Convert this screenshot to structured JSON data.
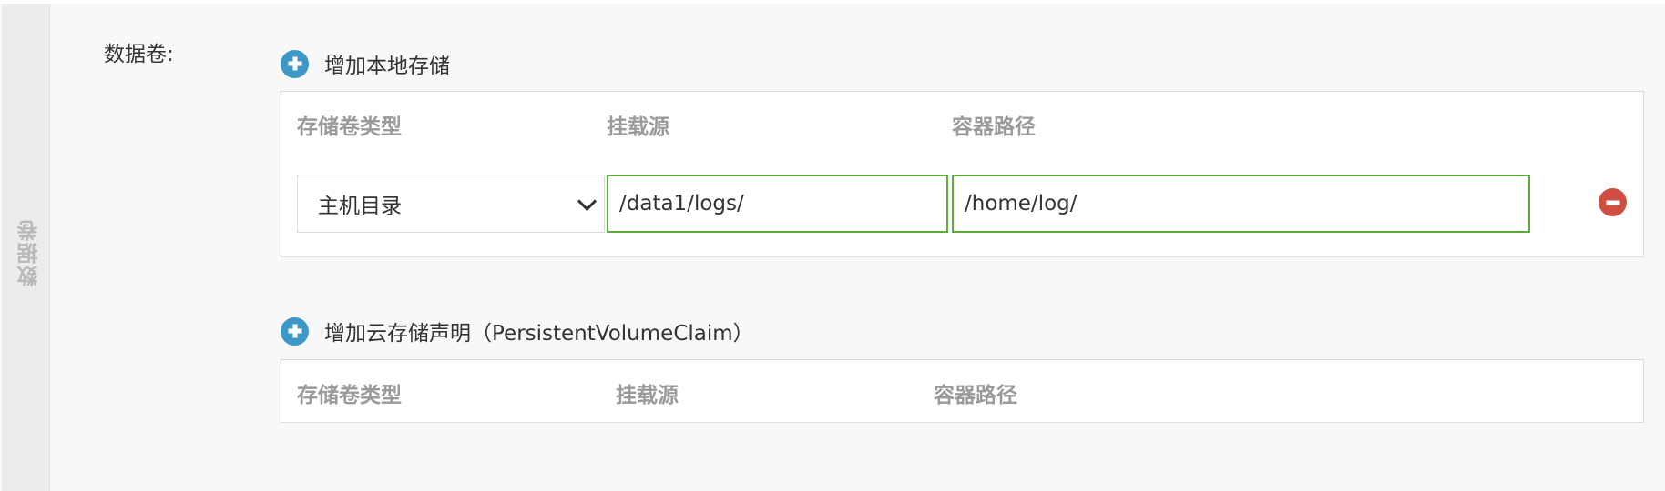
{
  "side_tab": {
    "label": "数据卷"
  },
  "field": {
    "label": "数据卷:"
  },
  "local_storage": {
    "add_label": "增加本地存储",
    "columns": [
      "存储卷类型",
      "挂载源",
      "容器路径"
    ],
    "rows": [
      {
        "type": "主机目录",
        "source": "/data1/logs/",
        "path": "/home/log/"
      }
    ]
  },
  "cloud_storage": {
    "add_label": "增加云存储声明（PersistentVolumeClaim）",
    "columns": [
      "存储卷类型",
      "挂载源",
      "容器路径"
    ]
  },
  "colors": {
    "add_icon": "#3d98c7",
    "remove_icon": "#cf4f43",
    "input_border_valid": "#5aad37"
  }
}
